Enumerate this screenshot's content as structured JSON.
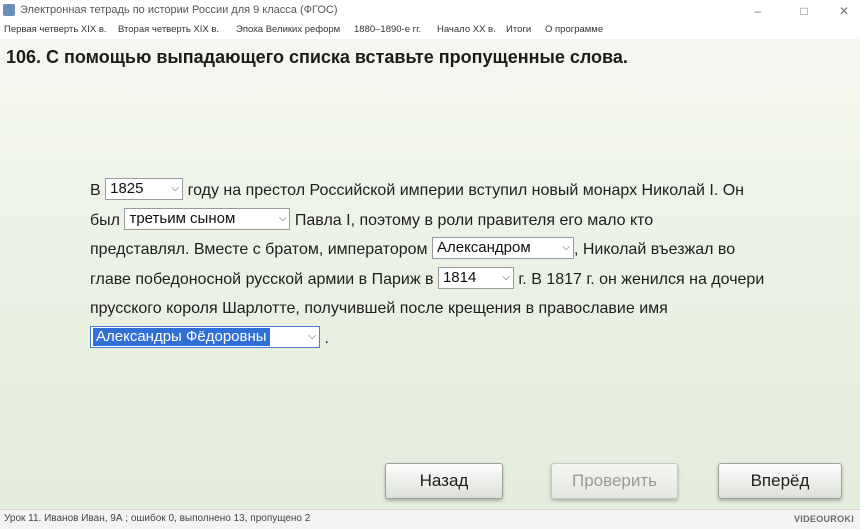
{
  "window": {
    "title": "Электронная тетрадь по истории России для 9 класса (ФГОС)",
    "minimize": "–",
    "maximize": "□",
    "close": "✕"
  },
  "menu": [
    "Первая четверть XIX в.",
    "Вторая четверть XIX в.",
    "Эпоха Великих реформ",
    "1880–1890-е гг.",
    "Начало XX в.",
    "Итоги",
    "О программе"
  ],
  "task": {
    "title": "106. С помощью выпадающего списка вставьте пропущенные слова."
  },
  "passage": {
    "l1_a": "В",
    "sel1": "1825",
    "l1_b": "году на престол Российской империи вступил новый монарх Николай I. Он",
    "l2_a": "был",
    "sel2": "третьим сыном",
    "l2_b": "Павла I, поэтому в роли правителя его мало кто",
    "l3_a": "представлял.  Вместе с братом, императором",
    "sel3": "Александром",
    "l3_b": ", Николай въезжал во",
    "l4_a": "главе победоносной русской армии в Париж в",
    "sel4": "1814",
    "l4_b": "г. В 1817 г. он женился на дочери",
    "l5": "прусского короля Шарлотте, получившей после крещения в православие имя",
    "sel5": "Александры Фёдоровны",
    "l6_b": "."
  },
  "buttons": {
    "back": "Назад",
    "check": "Проверить",
    "forward": "Вперёд"
  },
  "status": {
    "text": "Урок 11. Иванов Иван, 9А ; ошибок 0, выполнено 13, пропущено 2",
    "logo": "VIDEOUROKI"
  }
}
